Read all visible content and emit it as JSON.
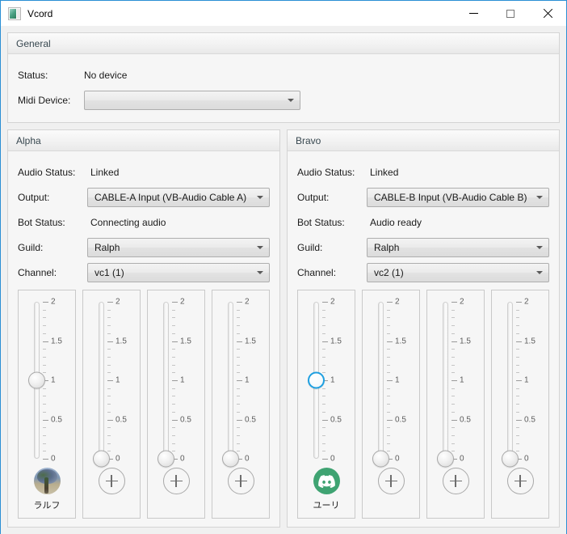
{
  "window": {
    "title": "Vcord",
    "icon": "app-window-icon",
    "border_color": "#2a8fd4",
    "controls": {
      "minimize": "–",
      "maximize": "□",
      "close": "✕"
    }
  },
  "general": {
    "header": "General",
    "status_label": "Status:",
    "status_value": "No device",
    "midi_label": "Midi Device:",
    "midi_value": "",
    "midi_placeholder": ""
  },
  "slider_scale": {
    "min": 0,
    "max": 2,
    "major_ticks": [
      "2",
      "1.5",
      "1",
      "0.5",
      "0"
    ],
    "major_values": [
      2,
      1.5,
      1,
      0.5,
      0
    ],
    "minor_step": 0.1
  },
  "labels": {
    "audio_status": "Audio Status:",
    "output": "Output:",
    "bot_status": "Bot Status:",
    "guild": "Guild:",
    "channel": "Channel:"
  },
  "panels": [
    {
      "header": "Alpha",
      "audio_status_value": "Linked",
      "output_value": "CABLE-A Input (VB-Audio Cable A)",
      "bot_status_value": "Connecting audio",
      "guild_value": "Ralph",
      "channel_value": "vc1 (1)",
      "strips": [
        {
          "value": 1,
          "kind": "avatar",
          "avatar_type": "photo",
          "label": "ラルフ",
          "focused": false
        },
        {
          "value": 0,
          "kind": "add",
          "label": "",
          "focused": false
        },
        {
          "value": 0,
          "kind": "add",
          "label": "",
          "focused": false
        },
        {
          "value": 0,
          "kind": "add",
          "label": "",
          "focused": false
        }
      ]
    },
    {
      "header": "Bravo",
      "audio_status_value": "Linked",
      "output_value": "CABLE-B Input (VB-Audio Cable B)",
      "bot_status_value": "Audio ready",
      "guild_value": "Ralph",
      "channel_value": "vc2 (1)",
      "strips": [
        {
          "value": 1,
          "kind": "avatar",
          "avatar_type": "discord",
          "label": "ユーリ",
          "focused": true
        },
        {
          "value": 0,
          "kind": "add",
          "label": "",
          "focused": false
        },
        {
          "value": 0,
          "kind": "add",
          "label": "",
          "focused": false
        },
        {
          "value": 0,
          "kind": "add",
          "label": "",
          "focused": false
        }
      ]
    }
  ],
  "colors": {
    "accent_focus": "#1e9fe0",
    "discord_green": "#3fa372",
    "window_border": "#2a8fd4",
    "client_bg": "#f0f0f0",
    "group_bg": "#f6f6f6"
  }
}
